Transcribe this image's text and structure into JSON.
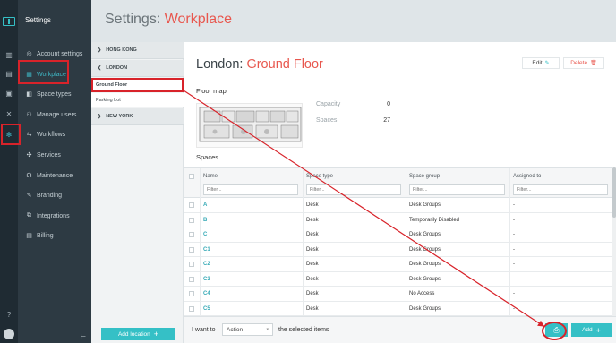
{
  "app": {
    "section_title": "Settings"
  },
  "rail": {
    "icons": [
      "building-icon",
      "grid-icon",
      "book-icon",
      "tools-icon",
      "gear-icon",
      "help-icon"
    ]
  },
  "menu": {
    "items": [
      {
        "label": "Account settings",
        "icon": "user-circle-icon",
        "glyph": "◎"
      },
      {
        "label": "Workplace",
        "icon": "building-icon",
        "glyph": "▦"
      },
      {
        "label": "Space types",
        "icon": "space-icon",
        "glyph": "◧"
      },
      {
        "label": "Manage users",
        "icon": "users-icon",
        "glyph": "⚇"
      },
      {
        "label": "Workflows",
        "icon": "workflow-icon",
        "glyph": "⇆"
      },
      {
        "label": "Services",
        "icon": "services-icon",
        "glyph": "✣"
      },
      {
        "label": "Maintenance",
        "icon": "headset-icon",
        "glyph": "☊"
      },
      {
        "label": "Branding",
        "icon": "branding-icon",
        "glyph": "✎"
      },
      {
        "label": "Integrations",
        "icon": "integrations-icon",
        "glyph": "⧉"
      },
      {
        "label": "Billing",
        "icon": "billing-icon",
        "glyph": "▤"
      }
    ],
    "collapse_glyph": "⊢"
  },
  "header": {
    "prefix": "Settings: ",
    "accent": "Workplace"
  },
  "locations": {
    "groups": [
      {
        "name": "HONG KONG",
        "chevron": "❯"
      },
      {
        "name": "LONDON",
        "chevron": "❮"
      },
      {
        "name": "NEW YORK",
        "chevron": "❯"
      }
    ],
    "london_floors": [
      "Ground Floor",
      "Parking Lot"
    ],
    "add_label": "Add location",
    "add_glyph": "+"
  },
  "floor": {
    "city": "London: ",
    "name": "Ground Floor",
    "edit_label": "Edit",
    "edit_glyph": "✎",
    "delete_label": "Delete",
    "delete_glyph": "🗑",
    "map_heading": "Floor map",
    "capacity_label": "Capacity",
    "capacity_value": "0",
    "spaces_label": "Spaces",
    "spaces_value": "27"
  },
  "spaces": {
    "heading": "Spaces",
    "columns": [
      "Name",
      "Space type",
      "Space group",
      "Assigned to"
    ],
    "filter_placeholder": "Filter...",
    "rows": [
      {
        "name": "A",
        "type": "Desk",
        "group": "Desk Groups",
        "assigned": "-"
      },
      {
        "name": "B",
        "type": "Desk",
        "group": "Temporarily Disabled",
        "assigned": "-"
      },
      {
        "name": "C",
        "type": "Desk",
        "group": "Desk Groups",
        "assigned": "-"
      },
      {
        "name": "C1",
        "type": "Desk",
        "group": "Desk Groups",
        "assigned": "-"
      },
      {
        "name": "C2",
        "type": "Desk",
        "group": "Desk Groups",
        "assigned": "-"
      },
      {
        "name": "C3",
        "type": "Desk",
        "group": "Desk Groups",
        "assigned": "-"
      },
      {
        "name": "C4",
        "type": "Desk",
        "group": "No Access",
        "assigned": "-"
      },
      {
        "name": "C5",
        "type": "Desk",
        "group": "Desk Groups",
        "assigned": "-"
      }
    ]
  },
  "footer": {
    "want_label": "I want to",
    "action_value": "Action",
    "action_chevron": "▾",
    "selected_label": "the selected items",
    "print_glyph": "⎙",
    "add_label": "Add",
    "add_glyph": "+"
  },
  "colors": {
    "accent": "#35c0c6",
    "title_accent": "#e8574e",
    "annotation": "#d8232a"
  }
}
